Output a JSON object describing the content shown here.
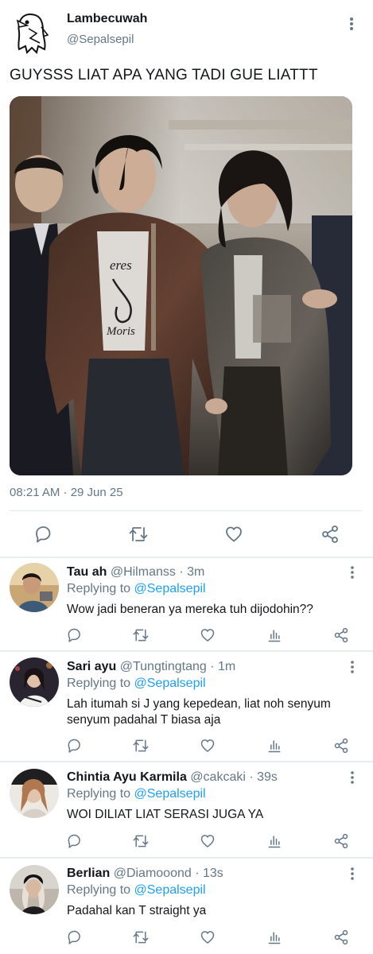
{
  "tweet": {
    "author_name": "Lambecuwah",
    "author_handle": "@Sepalsepil",
    "text": "GUYSSS LIAT APA YANG TADI GUE LIATTT",
    "timestamp": "08:21 AM · 29 Jun 25",
    "avatar_icon": "penguin-sketch-avatar",
    "photo_alt": "photo",
    "shirt_print": [
      "eres",
      "Moris"
    ]
  },
  "replies": [
    {
      "name": "Tau ah",
      "handle": "@Hilmanss",
      "time": "3m",
      "replying_prefix": "Replying to",
      "replying_to": "@Sepalsepil",
      "text": "Wow jadi beneran ya mereka tuh dijodohin??"
    },
    {
      "name": "Sari ayu",
      "handle": "@Tungtingtang",
      "time": "1m",
      "replying_prefix": "Replying to",
      "replying_to": "@Sepalsepil",
      "text": "Lah itumah si J yang kepedean, liat noh senyum senyum padahal T biasa aja"
    },
    {
      "name": "Chintia Ayu Karmila",
      "handle": "@cakcaki",
      "time": "39s",
      "replying_prefix": "Replying to",
      "replying_to": "@Sepalsepil",
      "text": "WOI DILIAT LIAT SERASI JUGA YA"
    },
    {
      "name": "Berlian",
      "handle": "@Diamooond",
      "time": "13s",
      "replying_prefix": "Replying to",
      "replying_to": "@Sepalsepil",
      "text": "Padahal kan T straight ya"
    }
  ],
  "separator": " · ",
  "colors": {
    "text_primary": "#14171a",
    "text_secondary": "#657786",
    "link": "#1da1f2",
    "divider": "#e6ecf0"
  },
  "icons": [
    "more-vertical-icon",
    "reply-icon",
    "retweet-icon",
    "like-icon",
    "share-icon",
    "analytics-icon"
  ]
}
